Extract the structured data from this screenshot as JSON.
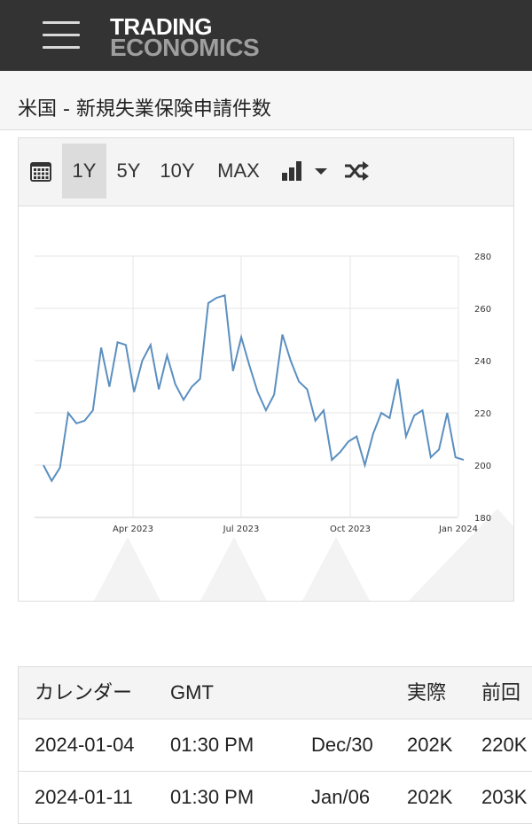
{
  "header": {
    "brand_line1": "TRADING",
    "brand_line2": "ECONOMICS"
  },
  "page_title": "米国 - 新規失業保険申請件数",
  "toolbar": {
    "range_1y": "1Y",
    "range_5y": "5Y",
    "range_10y": "10Y",
    "range_max": "MAX",
    "active_range": "1Y"
  },
  "chart_data": {
    "type": "line",
    "title": "",
    "xlabel": "",
    "ylabel": "",
    "ylim": [
      180,
      280
    ],
    "y_ticks": [
      "180",
      "200",
      "220",
      "240",
      "260",
      "280"
    ],
    "x_tick_labels": [
      "Apr 2023",
      "Jul 2023",
      "Oct 2023",
      "Jan 2024"
    ],
    "grid": true,
    "line_color": "#5b8fbf",
    "values": [
      200,
      194,
      199,
      220,
      216,
      217,
      221,
      245,
      230,
      247,
      246,
      228,
      240,
      246,
      229,
      242,
      231,
      225,
      230,
      233,
      262,
      264,
      265,
      236,
      249,
      238,
      228,
      221,
      227,
      250,
      240,
      232,
      229,
      217,
      221,
      202,
      205,
      209,
      211,
      200,
      212,
      220,
      218,
      233,
      211,
      219,
      221,
      203,
      206,
      220,
      203,
      202
    ]
  },
  "table": {
    "headers": [
      "カレンダー",
      "GMT",
      "",
      "実際",
      "前回"
    ],
    "rows": [
      [
        "2024-01-04",
        "01:30 PM",
        "Dec/30",
        "202K",
        "220K"
      ],
      [
        "2024-01-11",
        "01:30 PM",
        "Jan/06",
        "202K",
        "203K"
      ]
    ]
  }
}
